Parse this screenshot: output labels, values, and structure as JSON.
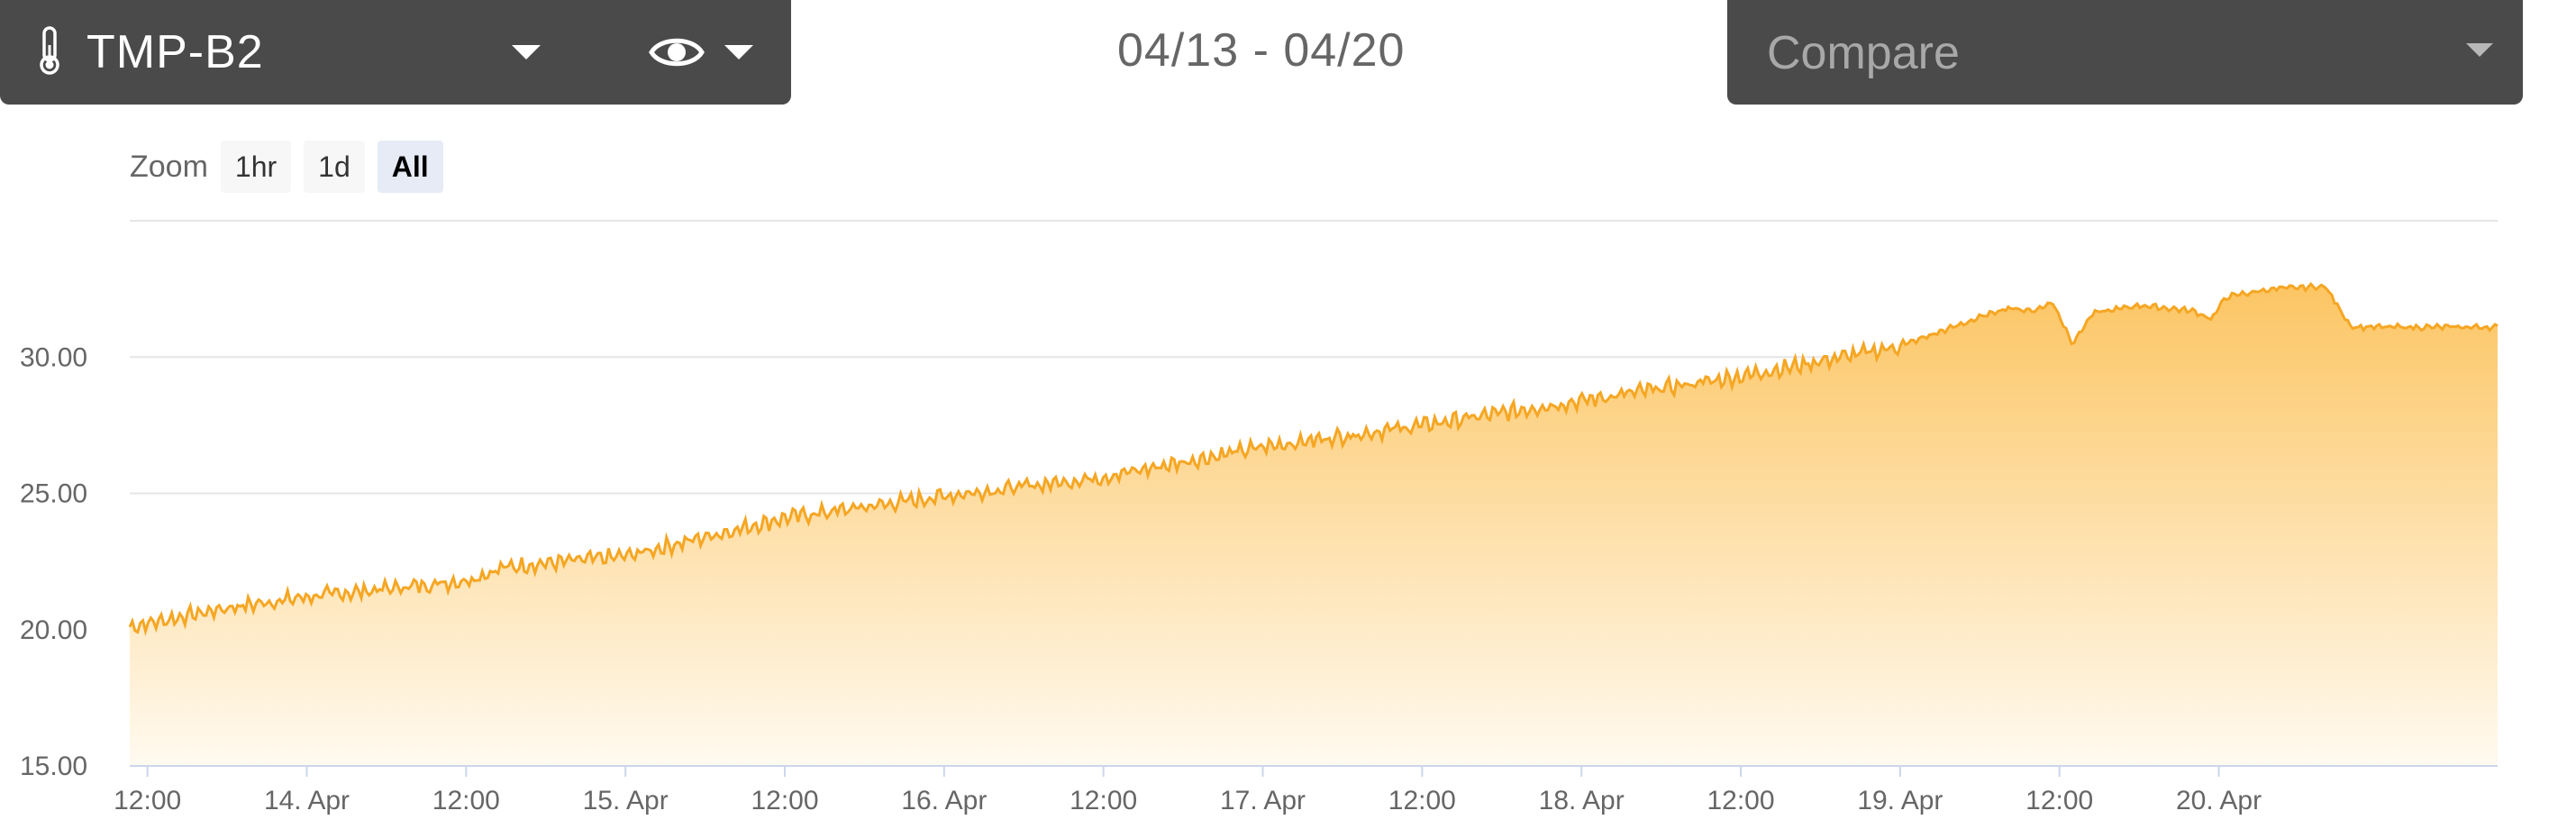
{
  "header": {
    "sensor_name": "TMP-B2",
    "sensor_icon": "thermometer-icon",
    "view_icon": "eye-icon",
    "date_range": "04/13 - 04/20",
    "compare_placeholder": "Compare"
  },
  "zoom": {
    "label": "Zoom",
    "buttons": [
      {
        "label": "1hr",
        "active": false
      },
      {
        "label": "1d",
        "active": false
      },
      {
        "label": "All",
        "active": true
      }
    ]
  },
  "colors": {
    "panel_bg": "#4a4a4a",
    "line": "#f5a623",
    "area_top": "#fcc563",
    "area_bottom": "#fffaf0",
    "grid": "#e6e6e6",
    "axis": "#ccd6eb"
  },
  "chart_data": {
    "type": "area",
    "title": "",
    "xlabel": "",
    "ylabel": "",
    "ylim": [
      15,
      35
    ],
    "xlim": [
      "2024-04-13T10:40",
      "2024-04-20T21:00"
    ],
    "grid": true,
    "legend": "none",
    "y_ticks": [
      "15.00",
      "20.00",
      "25.00",
      "30.00"
    ],
    "x_ticks": [
      "12:00",
      "14. Apr",
      "12:00",
      "15. Apr",
      "12:00",
      "16. Apr",
      "12:00",
      "17. Apr",
      "12:00",
      "18. Apr",
      "12:00",
      "19. Apr",
      "12:00",
      "20. Apr"
    ],
    "x_tick_times": [
      "2024-04-13T12:00",
      "2024-04-14T00:00",
      "2024-04-14T12:00",
      "2024-04-15T00:00",
      "2024-04-15T12:00",
      "2024-04-16T00:00",
      "2024-04-16T12:00",
      "2024-04-17T00:00",
      "2024-04-17T12:00",
      "2024-04-18T00:00",
      "2024-04-18T12:00",
      "2024-04-19T00:00",
      "2024-04-19T12:00",
      "2024-04-20T00:00"
    ],
    "series": [
      {
        "x": [
          "2024-04-13T10:40",
          "2024-04-13T18:00",
          "2024-04-14T00:00",
          "2024-04-14T12:00",
          "2024-04-14T15:00",
          "2024-04-15T00:00",
          "2024-04-15T12:00",
          "2024-04-16T00:00",
          "2024-04-16T12:00",
          "2024-04-17T00:00",
          "2024-04-17T12:00",
          "2024-04-18T00:00",
          "2024-04-18T12:00",
          "2024-04-19T00:00",
          "2024-04-19T08:00",
          "2024-04-19T10:00",
          "2024-04-19T11:30",
          "2024-04-19T13:00",
          "2024-04-19T14:30",
          "2024-04-19T18:00",
          "2024-04-19T22:00",
          "2024-04-19T23:30",
          "2024-04-20T00:30",
          "2024-04-20T04:00",
          "2024-04-20T08:00",
          "2024-04-20T10:00",
          "2024-04-20T21:00"
        ],
        "y": [
          20.1,
          20.8,
          21.2,
          21.8,
          22.3,
          22.7,
          24.1,
          24.9,
          25.6,
          26.7,
          27.5,
          28.4,
          29.3,
          30.4,
          31.8,
          31.7,
          32.0,
          30.5,
          31.6,
          31.9,
          31.7,
          31.4,
          32.2,
          32.5,
          32.6,
          31.1,
          31.1
        ]
      }
    ]
  }
}
